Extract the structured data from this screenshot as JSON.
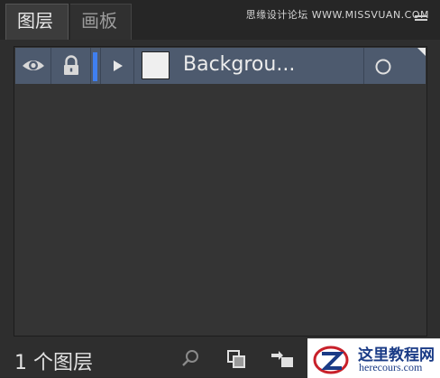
{
  "tabs": [
    {
      "label": "图层",
      "active": true
    },
    {
      "label": "画板",
      "active": false
    }
  ],
  "watermark_top": "思缘设计论坛 WWW.MISSVUAN.COM",
  "layer": {
    "name": "Backgrou...",
    "color": "#3f7ff0",
    "icons": {
      "visibility": "eye-icon",
      "lock": "lock-icon",
      "expand": "triangle-right-icon",
      "target": "circle-target-icon"
    }
  },
  "footer": {
    "count_label": "1 个图层",
    "icons": [
      "search-icon",
      "collect-icon",
      "move-to-layer-icon"
    ]
  },
  "badge": {
    "title": "这里教程网",
    "url": "herecours.com"
  }
}
